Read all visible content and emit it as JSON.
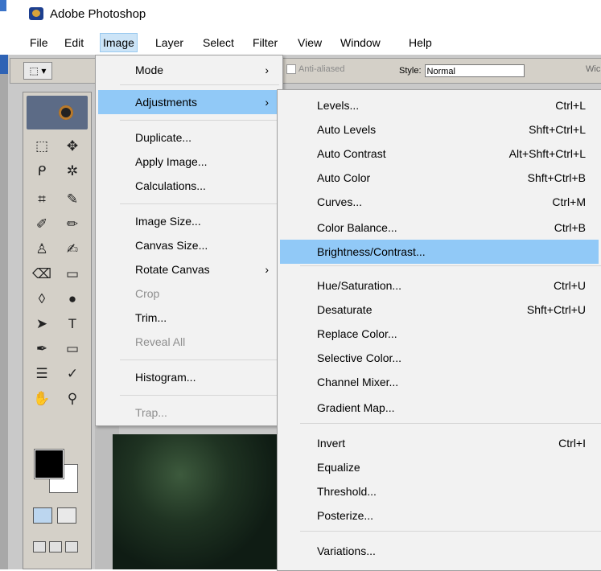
{
  "window": {
    "title": "Adobe Photoshop"
  },
  "menubar": [
    "File",
    "Edit",
    "Image",
    "Layer",
    "Select",
    "Filter",
    "View",
    "Window",
    "Help"
  ],
  "options_bar": {
    "anti_aliased": "Anti-aliased",
    "style_label": "Style:",
    "style_value": "Normal",
    "width_partial": "Wic"
  },
  "image_menu": [
    {
      "label": "Mode",
      "submenu": true
    },
    {
      "label": "Adjustments",
      "submenu": true,
      "highlighted": true
    },
    {
      "label": "Duplicate..."
    },
    {
      "label": "Apply Image..."
    },
    {
      "label": "Calculations..."
    },
    {
      "label": "Image Size..."
    },
    {
      "label": "Canvas Size..."
    },
    {
      "label": "Rotate Canvas",
      "submenu": true
    },
    {
      "label": "Crop",
      "disabled": true
    },
    {
      "label": "Trim..."
    },
    {
      "label": "Reveal All",
      "disabled": true
    },
    {
      "label": "Histogram..."
    },
    {
      "label": "Trap...",
      "disabled": true
    }
  ],
  "adjustments_menu": [
    {
      "label": "Levels...",
      "shortcut": "Ctrl+L"
    },
    {
      "label": "Auto Levels",
      "shortcut": "Shft+Ctrl+L"
    },
    {
      "label": "Auto Contrast",
      "shortcut": "Alt+Shft+Ctrl+L"
    },
    {
      "label": "Auto Color",
      "shortcut": "Shft+Ctrl+B"
    },
    {
      "label": "Curves...",
      "shortcut": "Ctrl+M"
    },
    {
      "label": "Color Balance...",
      "shortcut": "Ctrl+B"
    },
    {
      "label": "Brightness/Contrast...",
      "shortcut": "",
      "highlighted": true
    },
    {
      "label": "Hue/Saturation...",
      "shortcut": "Ctrl+U"
    },
    {
      "label": "Desaturate",
      "shortcut": "Shft+Ctrl+U"
    },
    {
      "label": "Replace Color...",
      "shortcut": ""
    },
    {
      "label": "Selective Color...",
      "shortcut": ""
    },
    {
      "label": "Channel Mixer...",
      "shortcut": ""
    },
    {
      "label": "Gradient Map...",
      "shortcut": ""
    },
    {
      "label": "Invert",
      "shortcut": "Ctrl+I"
    },
    {
      "label": "Equalize",
      "shortcut": ""
    },
    {
      "label": "Threshold...",
      "shortcut": ""
    },
    {
      "label": "Posterize...",
      "shortcut": ""
    },
    {
      "label": "Variations...",
      "shortcut": ""
    }
  ],
  "toolbox": {
    "tools": [
      {
        "name": "rect-marquee-tool-icon",
        "glyph": "⬚"
      },
      {
        "name": "move-tool-icon",
        "glyph": "✥"
      },
      {
        "name": "lasso-tool-icon",
        "glyph": "ᑭ"
      },
      {
        "name": "magic-wand-tool-icon",
        "glyph": "✲"
      },
      {
        "name": "crop-tool-icon",
        "glyph": "⌗"
      },
      {
        "name": "slice-tool-icon",
        "glyph": "✎"
      },
      {
        "name": "healing-brush-tool-icon",
        "glyph": "✐"
      },
      {
        "name": "brush-tool-icon",
        "glyph": "✏"
      },
      {
        "name": "clone-stamp-tool-icon",
        "glyph": "♙"
      },
      {
        "name": "history-brush-tool-icon",
        "glyph": "✍"
      },
      {
        "name": "eraser-tool-icon",
        "glyph": "⌫"
      },
      {
        "name": "gradient-tool-icon",
        "glyph": "▭"
      },
      {
        "name": "blur-tool-icon",
        "glyph": "◊"
      },
      {
        "name": "dodge-tool-icon",
        "glyph": "●"
      },
      {
        "name": "path-select-tool-icon",
        "glyph": "➤"
      },
      {
        "name": "type-tool-icon",
        "glyph": "T"
      },
      {
        "name": "pen-tool-icon",
        "glyph": "✒"
      },
      {
        "name": "shape-tool-icon",
        "glyph": "▭"
      },
      {
        "name": "notes-tool-icon",
        "glyph": "☰"
      },
      {
        "name": "eyedropper-tool-icon",
        "glyph": "✓"
      },
      {
        "name": "hand-tool-icon",
        "glyph": "✋"
      },
      {
        "name": "zoom-tool-icon",
        "glyph": "⚲"
      }
    ],
    "foreground_color": "#000000",
    "background_color": "#ffffff"
  },
  "colors": {
    "highlight": "#91c9f7",
    "menubar_active": "#cce4f7",
    "disabled_text": "#8d8d8d"
  }
}
